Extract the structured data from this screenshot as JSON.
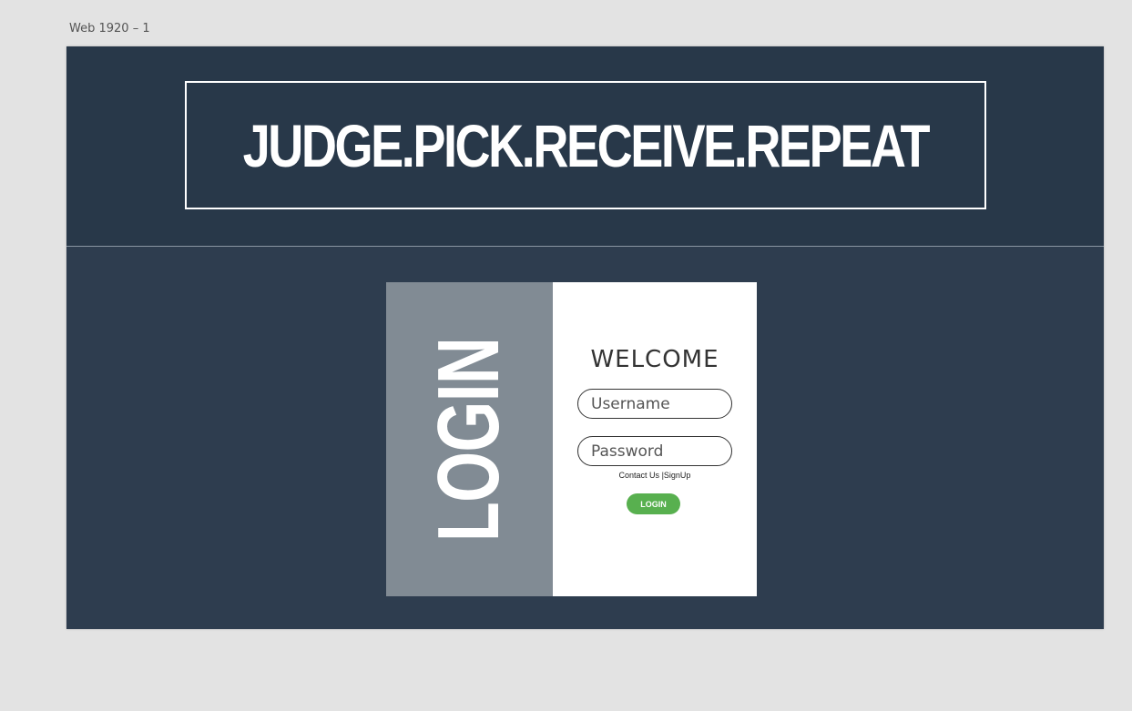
{
  "artboard": {
    "label": "Web 1920 – 1"
  },
  "banner": {
    "text": "JUDGE.PICK.RECEIVE.REPEAT"
  },
  "login_card": {
    "side_label": "LOGIN",
    "welcome": "WELCOME",
    "username_placeholder": "Username",
    "password_placeholder": "Password",
    "contact_link": "Contact Us",
    "separator": "|",
    "signup_link": "SignUp",
    "login_button": "LOGIN"
  },
  "colors": {
    "canvas_background": "#e3e3e3",
    "page_background": "#2e3d4f",
    "header_background": "#283849",
    "side_panel": "#818b94",
    "login_button": "#58b04f"
  }
}
